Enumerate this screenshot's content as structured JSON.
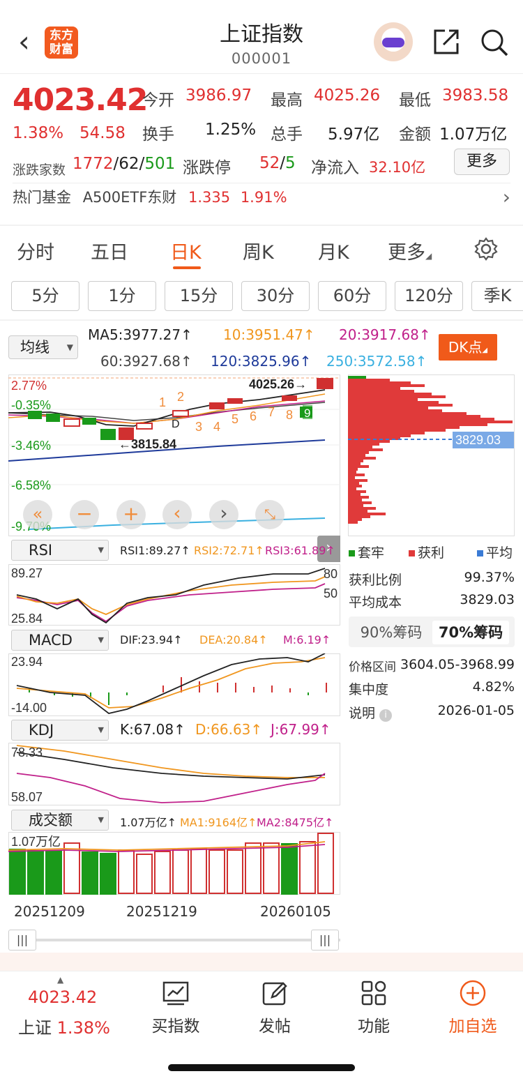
{
  "header": {
    "logo_text": "东方财富",
    "title": "上证指数",
    "code": "000001"
  },
  "quote": {
    "price": "4023.42",
    "change_pct": "1.38%",
    "change": "54.58",
    "open_label": "今开",
    "open": "3986.97",
    "high_label": "最高",
    "high": "4025.26",
    "low_label": "最低",
    "low": "3983.58",
    "turnover_label": "换手",
    "turnover": "1.25%",
    "volume_label": "总手",
    "volume": "5.97亿",
    "amount_label": "金额",
    "amount": "1.07万亿",
    "advdec_label": "涨跌家数",
    "adv": "1772",
    "flat": "62",
    "dec": "501",
    "limit_label": "涨跌停",
    "limit_up": "52",
    "limit_down": "5",
    "inflow_label": "净流入",
    "inflow": "32.10亿",
    "more_label": "更多",
    "fund_label": "热门基金",
    "fund_name": "A500ETF东财",
    "fund_price": "1.335",
    "fund_pct": "1.91%"
  },
  "period_tabs": [
    "分时",
    "五日",
    "日K",
    "周K",
    "月K",
    "更多"
  ],
  "minute_buttons": [
    "5分",
    "1分",
    "15分",
    "30分",
    "60分",
    "120分",
    "季K"
  ],
  "ma": {
    "selector": "均线",
    "ma5": "MA5:3977.27↑",
    "ma10": "10:3951.47↑",
    "ma20": "20:3917.68↑",
    "ma60": "60:3927.68↑",
    "ma120": "120:3825.96↑",
    "ma250": "250:3572.58↑",
    "dk_label": "DK点"
  },
  "kline": {
    "pct_labels": [
      "2.77%",
      "-0.35%",
      "-3.46%",
      "-6.58%",
      "-9.70%"
    ],
    "high_mark": "4025.26→",
    "low_mark": "←3815.84",
    "d_mark": "D",
    "numbers": [
      "1",
      "2",
      "3",
      "4",
      "5",
      "6",
      "7",
      "8",
      "9"
    ]
  },
  "rsi": {
    "selector": "RSI",
    "rsi1": "RSI1:89.27↑",
    "rsi2": "RSI2:72.71↑",
    "rsi3": "RSI3:61.89↑",
    "top": "89.27",
    "bottom": "25.84",
    "r80": "80",
    "r50": "50"
  },
  "macd": {
    "selector": "MACD",
    "dif": "DIF:23.94↑",
    "dea": "DEA:20.84↑",
    "m": "M:6.19↑",
    "top": "23.94",
    "bottom": "-14.00"
  },
  "kdj": {
    "selector": "KDJ",
    "k": "K:67.08↑",
    "d": "D:66.63↑",
    "j": "J:67.99↑",
    "top": "78.33",
    "bottom": "58.07"
  },
  "vol": {
    "selector": "成交额",
    "v": "1.07万亿↑",
    "ma1": "MA1:9164亿↑",
    "ma2": "MA2:8475亿↑",
    "top": "1.07万亿"
  },
  "dates": [
    "20251209",
    "20251219",
    "20260105"
  ],
  "chips": {
    "price_label": "3829.03",
    "legend_trapped": "套牢",
    "legend_profit": "获利",
    "legend_avg": "平均",
    "profit_ratio_label": "获利比例",
    "profit_ratio": "99.37%",
    "avg_cost_label": "平均成本",
    "avg_cost": "3829.03",
    "tab90": "90%筹码",
    "tab70": "70%筹码",
    "range_label": "价格区间",
    "range": "3604.05-3968.99",
    "concentration_label": "集中度",
    "concentration": "4.82%",
    "note_label": "说明",
    "note_date": "2026-01-05"
  },
  "bottom": {
    "price": "4023.42",
    "name": "上证",
    "pct": "1.38%",
    "buy": "买指数",
    "post": "发帖",
    "func": "功能",
    "add": "加自选"
  },
  "colors": {
    "up": "#e03030",
    "down": "#1a9a1a",
    "accent": "#f05a1a"
  }
}
